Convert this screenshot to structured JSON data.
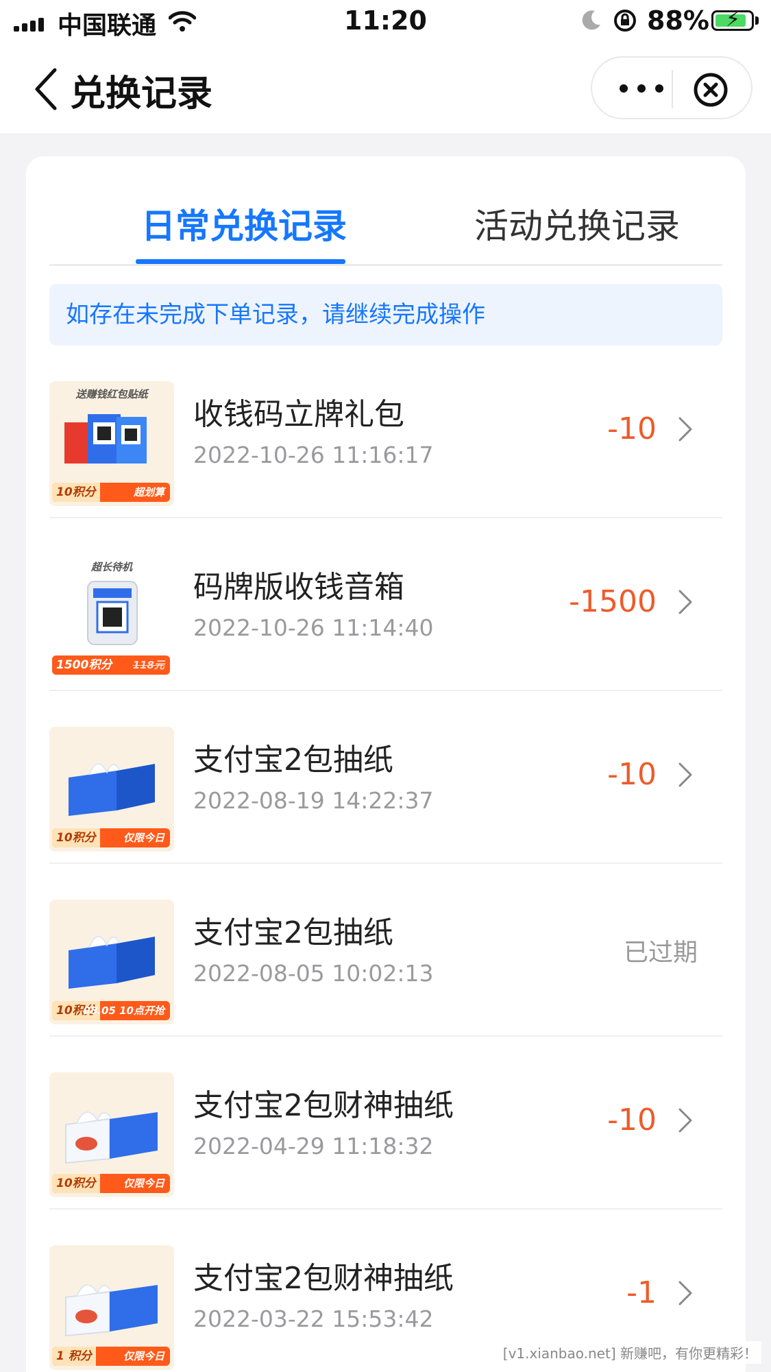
{
  "status_bar": {
    "carrier": "中国联通",
    "time": "11:20",
    "battery": "88%",
    "battery_level": 0.88,
    "battery_color": "#4cd964"
  },
  "nav": {
    "title": "兑换记录",
    "back_icon": "chevron-left-icon",
    "more_icon": "more-dots-icon",
    "close_icon": "close-circle-icon"
  },
  "tabs": [
    {
      "label": "日常兑换记录",
      "active": true
    },
    {
      "label": "活动兑换记录",
      "active": false
    }
  ],
  "notice": "如存在未完成下单记录，请继续完成操作",
  "colors": {
    "accent": "#1677ff",
    "points": "#ee5b2a",
    "expired": "#999999"
  },
  "records": [
    {
      "name": "收钱码立牌礼包",
      "time": "2022-10-26 11:16:17",
      "points": "-10",
      "thumb": {
        "caption": "送赚钱红包贴纸",
        "pts": "10积分",
        "promo": "超划算"
      }
    },
    {
      "name": "码牌版收钱音箱",
      "time": "2022-10-26 11:14:40",
      "points": "-1500",
      "thumb": {
        "caption": "超长待机",
        "pts": "1500积分",
        "promo": "118元"
      }
    },
    {
      "name": "支付宝2包抽纸",
      "time": "2022-08-19 14:22:37",
      "points": "-10",
      "thumb": {
        "caption": "",
        "pts": "10积分",
        "promo": "仅限今日"
      }
    },
    {
      "name": "支付宝2包抽纸",
      "time": "2022-08-05 10:02:13",
      "status": "已过期",
      "thumb": {
        "caption": "",
        "pts": "10积分",
        "promo": "08.05 10点开抢"
      }
    },
    {
      "name": "支付宝2包财神抽纸",
      "time": "2022-04-29 11:18:32",
      "points": "-10",
      "thumb": {
        "caption": "",
        "pts": "10积分",
        "promo": "仅限今日"
      }
    },
    {
      "name": "支付宝2包财神抽纸",
      "time": "2022-03-22 15:53:42",
      "points": "-1",
      "thumb": {
        "caption": "",
        "pts": "1 积分",
        "promo": "仅限今日"
      }
    }
  ],
  "watermark": "[v1.xianbao.net] 新赚吧，有你更精彩！"
}
